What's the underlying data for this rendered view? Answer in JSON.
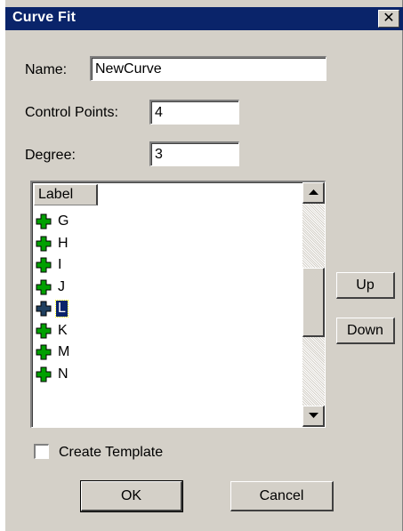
{
  "window": {
    "title": "Curve Fit",
    "close_glyph": "✕"
  },
  "form": {
    "name_label": "Name:",
    "name_value": "NewCurve",
    "control_points_label": "Control Points:",
    "control_points_value": "4",
    "degree_label": "Degree:",
    "degree_value": "3"
  },
  "list": {
    "header": "Label",
    "items": [
      {
        "label": "G",
        "icon": "green-plus-icon",
        "selected": false
      },
      {
        "label": "H",
        "icon": "green-plus-icon",
        "selected": false
      },
      {
        "label": "I",
        "icon": "green-plus-icon",
        "selected": false
      },
      {
        "label": "J",
        "icon": "green-plus-icon",
        "selected": false
      },
      {
        "label": "L",
        "icon": "green-plus-icon",
        "selected": true
      },
      {
        "label": "K",
        "icon": "green-plus-icon",
        "selected": false
      },
      {
        "label": "M",
        "icon": "green-plus-icon",
        "selected": false
      },
      {
        "label": "N",
        "icon": "green-plus-icon",
        "selected": false
      }
    ]
  },
  "buttons": {
    "up": "Up",
    "down": "Down",
    "ok": "OK",
    "cancel": "Cancel"
  },
  "options": {
    "create_template_label": "Create Template",
    "create_template_checked": false
  },
  "colors": {
    "titlebar": "#0a246a",
    "face": "#d4d0c8",
    "selection": "#0a246a",
    "plus_icon": "#00a000"
  }
}
